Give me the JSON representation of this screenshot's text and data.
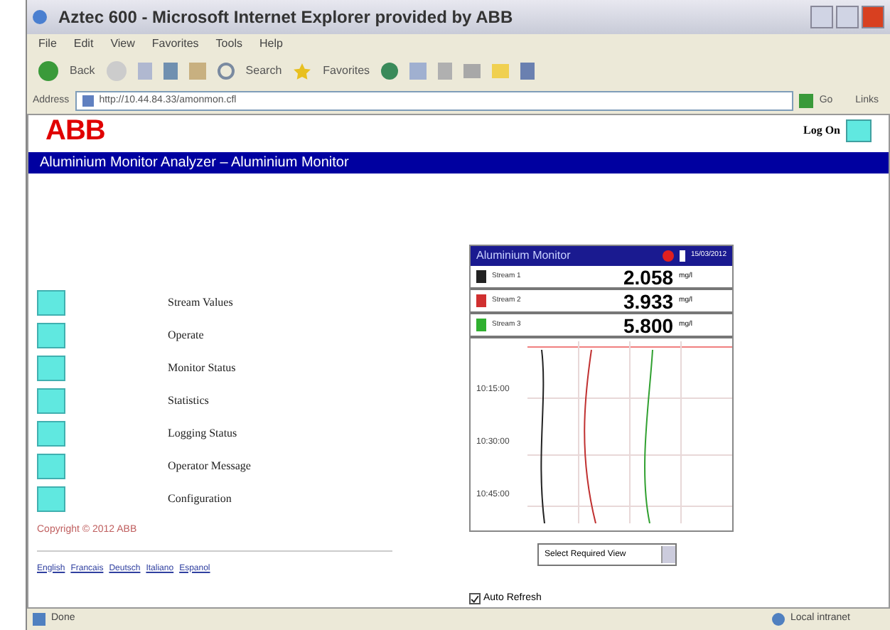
{
  "window": {
    "title": "Aztec 600 - Microsoft Internet Explorer provided by ABB"
  },
  "menu_bar": [
    "File",
    "Edit",
    "View",
    "Favorites",
    "Tools",
    "Help"
  ],
  "toolbar": {
    "back": "Back",
    "search": "Search",
    "favorites": "Favorites"
  },
  "address_bar": {
    "label": "Address",
    "value": "http://10.44.84.33/amonmon.cfl",
    "go": "Go",
    "links": "Links"
  },
  "page": {
    "logo": "ABB",
    "log_on": "Log On",
    "banner": "Aluminium Monitor Analyzer – Aluminium Monitor",
    "menu": [
      "Stream Values",
      "Operate",
      "Monitor Status",
      "Statistics",
      "Logging Status",
      "Operator Message",
      "Configuration"
    ],
    "copyright": "Copyright © 2012 ABB",
    "footer_links": [
      "English",
      "Francais",
      "Deutsch",
      "Italiano",
      "Espanol"
    ]
  },
  "monitor": {
    "title": "Aluminium Monitor",
    "date": "15/03/2012",
    "streams": [
      {
        "label": "Stream 1",
        "value": "2.058",
        "unit": "mg/l",
        "color": "#222222"
      },
      {
        "label": "Stream 2",
        "value": "3.933",
        "unit": "mg/l",
        "color": "#d03030"
      },
      {
        "label": "Stream 3",
        "value": "5.800",
        "unit": "mg/l",
        "color": "#30b030"
      }
    ],
    "times": [
      "10:15:00",
      "10:30:00",
      "10:45:00"
    ]
  },
  "view_select": {
    "value": "Select Required View"
  },
  "auto_refresh": {
    "label": "Auto Refresh",
    "checked": true
  },
  "status_bar": {
    "left": "Done",
    "right": "Local intranet"
  }
}
